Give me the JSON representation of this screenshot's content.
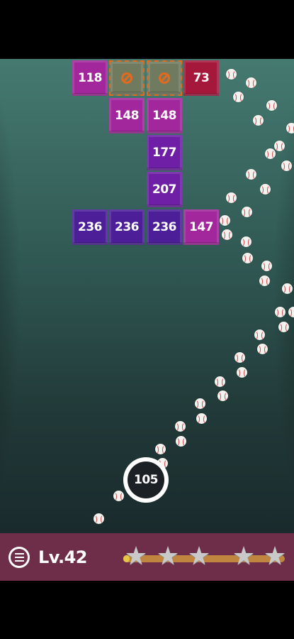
{
  "bricks": [
    {
      "label": "118",
      "style": "magenta"
    },
    {
      "label": "",
      "style": "locked",
      "icon": "no-entry-icon"
    },
    {
      "label": "",
      "style": "locked",
      "icon": "no-entry-icon"
    },
    {
      "label": "73",
      "style": "red"
    },
    {
      "label": "148",
      "style": "magenta"
    },
    {
      "label": "148",
      "style": "magenta"
    },
    {
      "label": "177",
      "style": "violet"
    },
    {
      "label": "207",
      "style": "violet"
    },
    {
      "label": "236",
      "style": "indigo"
    },
    {
      "label": "236",
      "style": "indigo"
    },
    {
      "label": "236",
      "style": "indigo"
    },
    {
      "label": "147",
      "style": "magenta"
    }
  ],
  "launcher": {
    "ball_count": "105"
  },
  "hud": {
    "level": "Lv.42",
    "progress": 0.04,
    "stars_total": 5
  },
  "colors": {
    "background_top": "#457a70",
    "background_bottom": "#1a2a2c",
    "hud": "#6e2d49",
    "progress_track": "#c0853e",
    "progress_fill": "#e7c545",
    "brick_magenta": "#a2279c",
    "brick_violet": "#6e1fa6",
    "brick_indigo": "#4c1f99",
    "brick_red": "#a5183c",
    "lock_orange": "#e06b20"
  }
}
